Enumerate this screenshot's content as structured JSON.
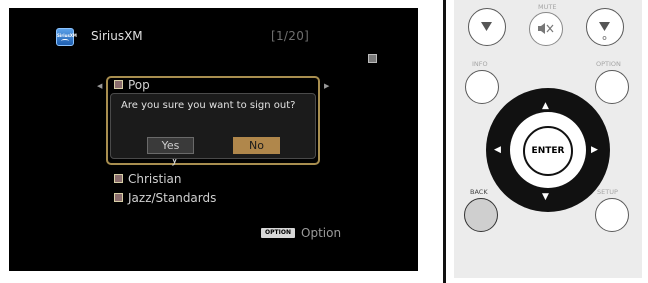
{
  "tv_screen": {
    "app_logo_text": "SiriusXM",
    "app_title": "SiriusXM",
    "page_counter": "[1/20]",
    "list_items": [
      "Pop",
      "Christian",
      "Jazz/Standards"
    ],
    "list_partial_text": "y",
    "dialog": {
      "message": "Are you sure you want to sign out?",
      "yes_label": "Yes",
      "no_label": "No",
      "selected": "No"
    },
    "option_badge": "OPTION",
    "option_label": "Option"
  },
  "remote": {
    "mute_label": "MUTE",
    "info_label": "INFO",
    "option_label": "OPTION",
    "enter_label": "ENTER",
    "back_label": "BACK",
    "setup_label": "SETUP",
    "icons": [
      "volume-down-icon",
      "mute-icon",
      "volume-up-icon",
      "arrow-up-icon",
      "arrow-down-icon",
      "arrow-left-icon",
      "arrow-right-icon"
    ]
  },
  "colors": {
    "screen_bg": "#000000",
    "frame_gold": "#a88e4f",
    "no_button": "#b0874b",
    "remote_bg": "#ececec"
  }
}
